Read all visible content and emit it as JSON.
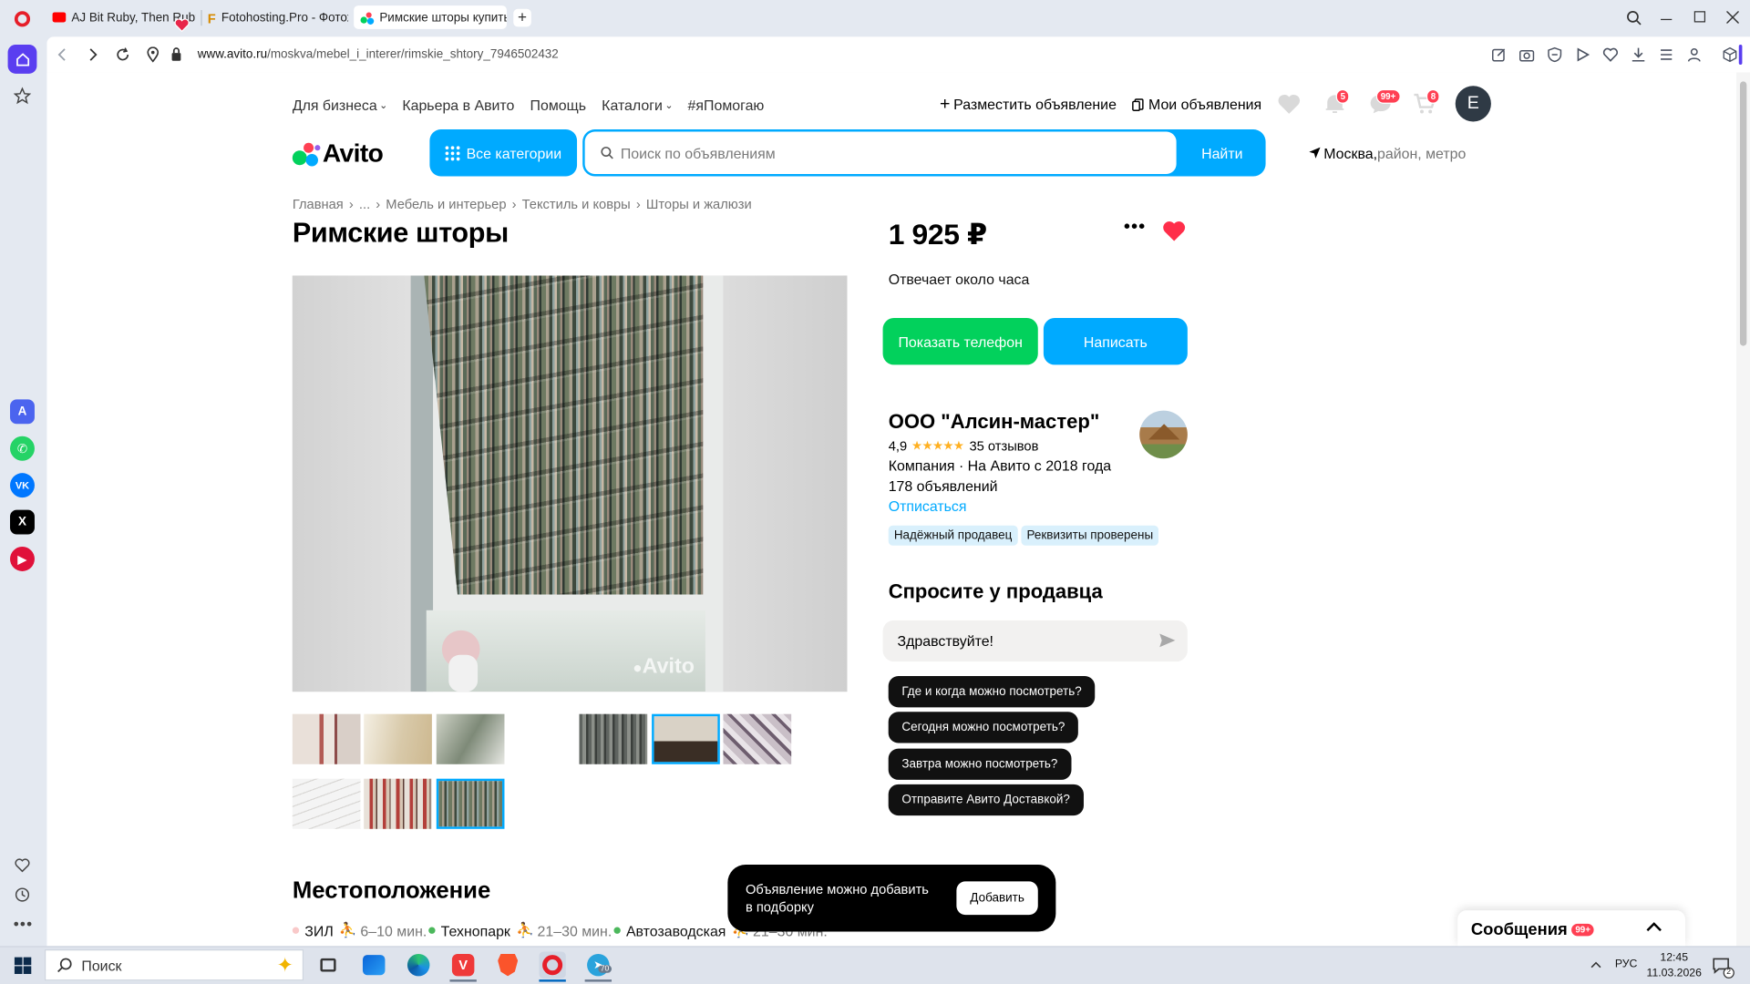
{
  "browser": {
    "tabs": [
      {
        "label": "AJ Bit Ruby, Then Ruby Fo",
        "icon": "youtube-icon",
        "active": false
      },
      {
        "label": "Fotohosting.Pro - Фотохо",
        "icon": "fotohosting-icon",
        "active": false
      },
      {
        "label": "Римские шторы купить в",
        "icon": "avito-icon",
        "active": true
      }
    ],
    "new_tab": "+",
    "url_host": "www.avito.ru",
    "url_path": "/moskva/mebel_i_interer/rimskie_shtory_7946502432"
  },
  "top_nav": {
    "links": [
      "Для бизнеса",
      "Карьера в Авито",
      "Помощь",
      "Каталоги",
      "#яПомогаю"
    ],
    "post_ad": "Разместить объявление",
    "my_ads": "Мои объявления",
    "notifications_count": "5",
    "messages_count": "99+",
    "cart_count": "8",
    "avatar_letter": "E"
  },
  "header": {
    "logo": "Avito",
    "categories_button": "Все категории",
    "search_placeholder": "Поиск по объявлениям",
    "search_button": "Найти",
    "location_city": "Москва,",
    "location_hint": " район, метро"
  },
  "breadcrumbs": [
    "Главная",
    "...",
    "Мебель и интерьер",
    "Текстиль и ковры",
    "Шторы и жалюзи"
  ],
  "listing": {
    "title": "Римские шторы",
    "price": "1 925 ₽",
    "response_time": "Отвечает около часа",
    "show_phone": "Показать телефон",
    "write": "Написать",
    "watermark": "Avito"
  },
  "seller": {
    "name": "ООО \"Алсин-мастер\"",
    "rating": "4,9",
    "stars": 5,
    "reviews": "35 отзывов",
    "company_info": "Компания · На Авито с 2018 года",
    "ads_count": "178 объявлений",
    "unsubscribe": "Отписаться",
    "tags": [
      "Надёжный продавец",
      "Реквизиты проверены"
    ]
  },
  "ask": {
    "heading": "Спросите у продавца",
    "input_value": "Здравствуйте!",
    "chips": [
      "Где и когда можно посмотреть?",
      "Сегодня можно посмотреть?",
      "Завтра можно посмотреть?",
      "Отправите Авито Доставкой?"
    ]
  },
  "location": {
    "heading": "Местоположение",
    "metro": [
      {
        "station": "ЗИЛ",
        "time": "6–10 мин.",
        "color": "#f9c9c9"
      },
      {
        "station": "Технопарк",
        "time": "21–30 мин.",
        "color": "#4cb85c"
      },
      {
        "station": "Автозаводская",
        "time": "21–30 мин.",
        "color": "#4cb85c"
      }
    ]
  },
  "toast": {
    "text_line1": "Объявление можно добавить",
    "text_line2": "в подборку",
    "button": "Добавить"
  },
  "messenger": {
    "label": "Сообщения",
    "count": "99+"
  },
  "taskbar": {
    "search_label": "Поиск",
    "language": "РУС",
    "time": "12:45",
    "date": "11.03.2026",
    "notifications": "2",
    "telegram_badge": "70"
  },
  "colors": {
    "avito_blue": "#00aaff",
    "green": "#02d15c",
    "like_red": "#ff2e4a",
    "badge_red": "#ff4053"
  }
}
